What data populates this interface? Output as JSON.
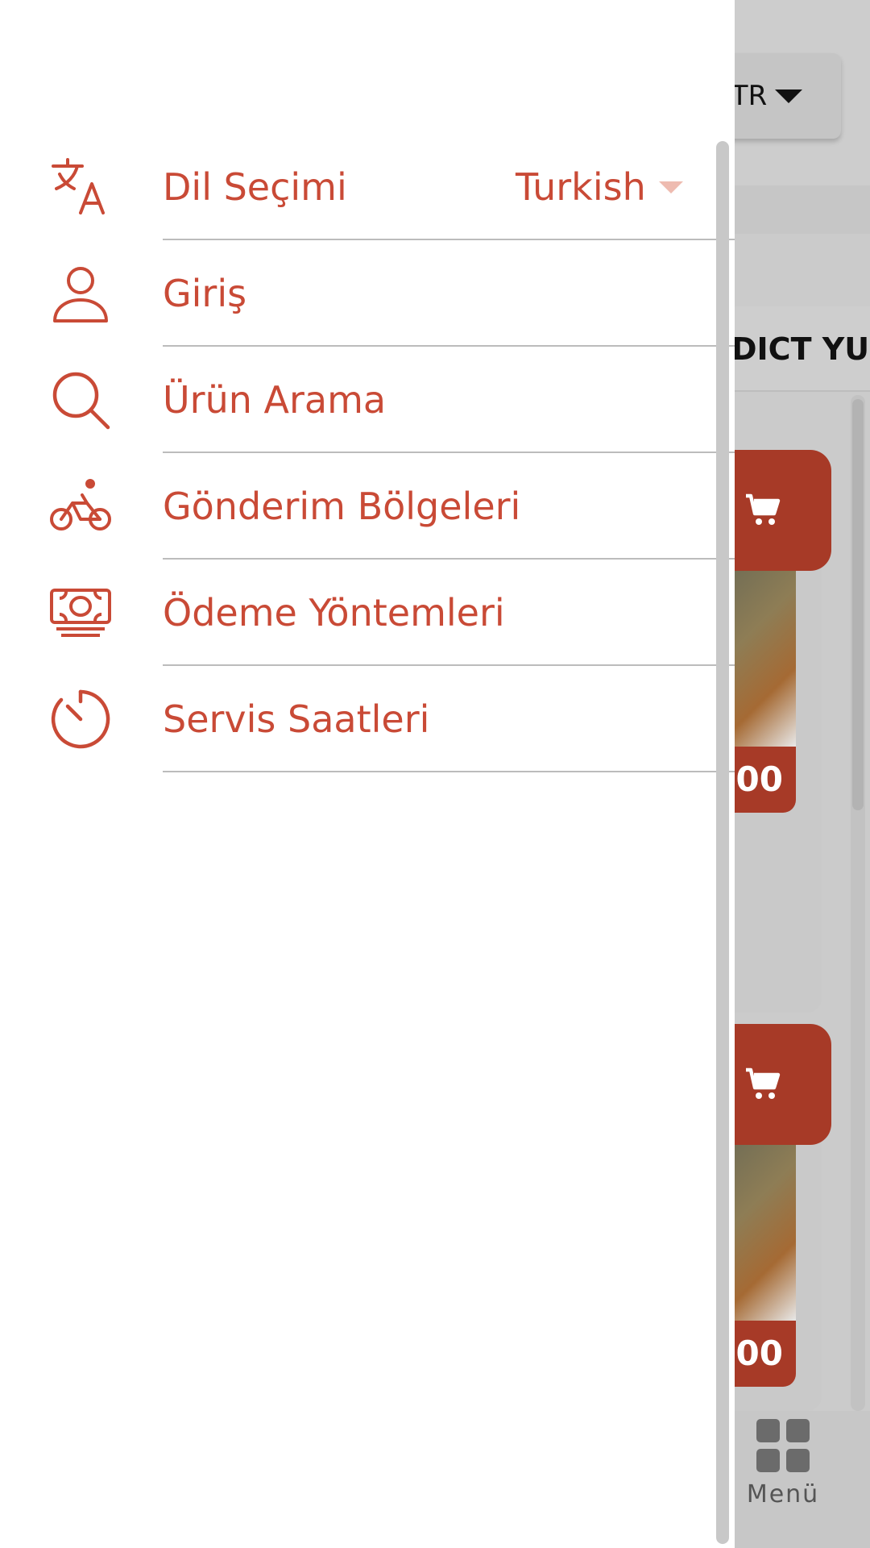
{
  "background": {
    "language_button": {
      "label": "TR"
    },
    "category_heading": "DICT YUM",
    "products": [
      {
        "price_text": "00"
      },
      {
        "price_text": "00"
      }
    ],
    "bottom_nav": {
      "menu_label": "Menü"
    }
  },
  "drawer": {
    "items": [
      {
        "label": "Dil Seçimi",
        "icon": "translate-icon",
        "selected_language": "Turkish"
      },
      {
        "label": "Giriş",
        "icon": "person-icon"
      },
      {
        "label": "Ürün Arama",
        "icon": "search-icon"
      },
      {
        "label": "Gönderim Bölgeleri",
        "icon": "bicycle-icon"
      },
      {
        "label": "Ödeme Yöntemleri",
        "icon": "money-icon"
      },
      {
        "label": "Servis Saatleri",
        "icon": "timer-icon"
      }
    ]
  },
  "colors": {
    "accent": "#c94a36",
    "cart_button": "#a73a27",
    "caret_light": "#eebbb0",
    "overlay": "#cbcbcb"
  }
}
